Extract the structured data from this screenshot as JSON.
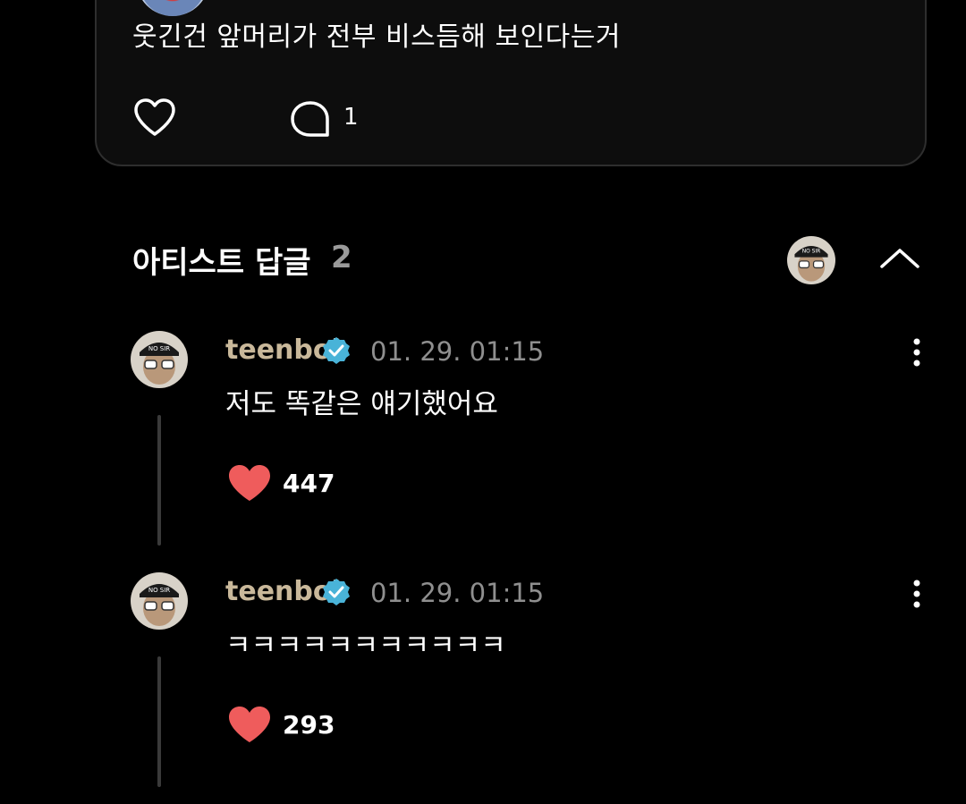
{
  "parent_comment": {
    "text": "웃긴건 앞머리가 전부 비스듬해 보인다는거",
    "reply_count": "1"
  },
  "artist_replies_section": {
    "title": "아티스트 답글",
    "count": "2"
  },
  "replies": [
    {
      "username": "teenboi",
      "timestamp": "01. 29. 01:15",
      "text": "저도 똑같은 얘기했어요",
      "likes": "447"
    },
    {
      "username": "teenboi",
      "timestamp": "01. 29. 01:15",
      "text": "ㅋㅋㅋㅋㅋㅋㅋㅋㅋㅋㅋ",
      "likes": "293"
    }
  ],
  "colors": {
    "background": "#000000",
    "heart_filled": "#ef5c5c",
    "verified_badge": "#49b3d8",
    "username": "#c9b89a",
    "muted_text": "#8f8f8f"
  },
  "icons": {
    "like_outline": "heart-outline-icon",
    "reply": "chat-bubble-icon",
    "collapse": "chevron-up-icon",
    "more": "more-vertical-icon",
    "verified": "verified-badge-icon",
    "like_filled": "heart-filled-icon"
  }
}
